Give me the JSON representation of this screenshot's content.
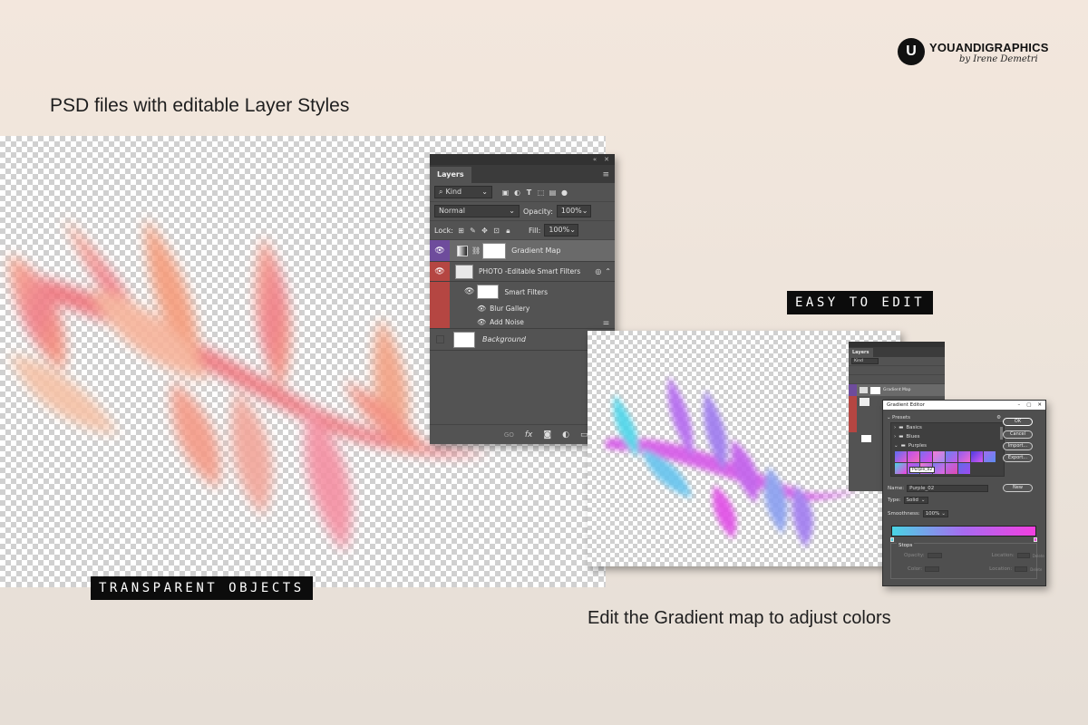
{
  "brand": {
    "name": "YOUANDIGRAPHICS",
    "signature": "by Irene Demetri",
    "logo_letters": "U"
  },
  "headline": "PSD files with editable Layer Styles",
  "caption_edit": "Edit the Gradient map to adjust colors",
  "tag_transparent": "TRANSPARENT OBJECTS",
  "tag_easy": "EASY TO EDIT",
  "layers_panel": {
    "tab": "Layers",
    "kind_filter": "Kind",
    "blend_mode": "Normal",
    "opacity_label": "Opacity:",
    "opacity_value": "100%",
    "lock_label": "Lock:",
    "fill_label": "Fill:",
    "fill_value": "100%",
    "layers": [
      {
        "name": "Gradient Map"
      },
      {
        "name": "PHOTO -Editable Smart Filters"
      },
      {
        "name": "Smart Filters"
      },
      {
        "name": "Blur Gallery"
      },
      {
        "name": "Add Noise"
      },
      {
        "name": "Background"
      }
    ],
    "footer_icons": [
      "link-icon",
      "fx-icon",
      "mask-icon",
      "adjustment-icon",
      "folder-icon",
      "new-layer-icon"
    ],
    "fx_glyph": "fx",
    "go_glyph": "GO"
  },
  "mini_layers": {
    "tab": "Layers",
    "kind": "Kind",
    "layer_top": "Gradient Map"
  },
  "gradient_editor": {
    "title": "Gradient Editor",
    "presets_label": "Presets",
    "folders": [
      "Basics",
      "Blues",
      "Purples"
    ],
    "selected_preset": "Purple_02",
    "buttons": {
      "ok": "OK",
      "cancel": "Cancel",
      "import": "Import...",
      "export": "Export...",
      "new": "New"
    },
    "name_label": "Name:",
    "name_value": "Purple_02",
    "type_label": "Type:",
    "type_value": "Solid",
    "smoothness_label": "Smoothness:",
    "smoothness_value": "100%",
    "stops_label": "Stops",
    "opacity_label": "Opacity:",
    "color_label": "Color:",
    "location_label_1": "Location:",
    "location_label_2": "Location:",
    "delete_label_1": "Delete",
    "delete_label_2": "Delete",
    "gradient_colors": [
      "#49d4e4",
      "#a86bf0",
      "#f33fe0"
    ]
  },
  "colors": {
    "layer_purple": "#6e4c9c",
    "layer_red": "#b54642",
    "tag_bg": "#0c0c0c"
  }
}
